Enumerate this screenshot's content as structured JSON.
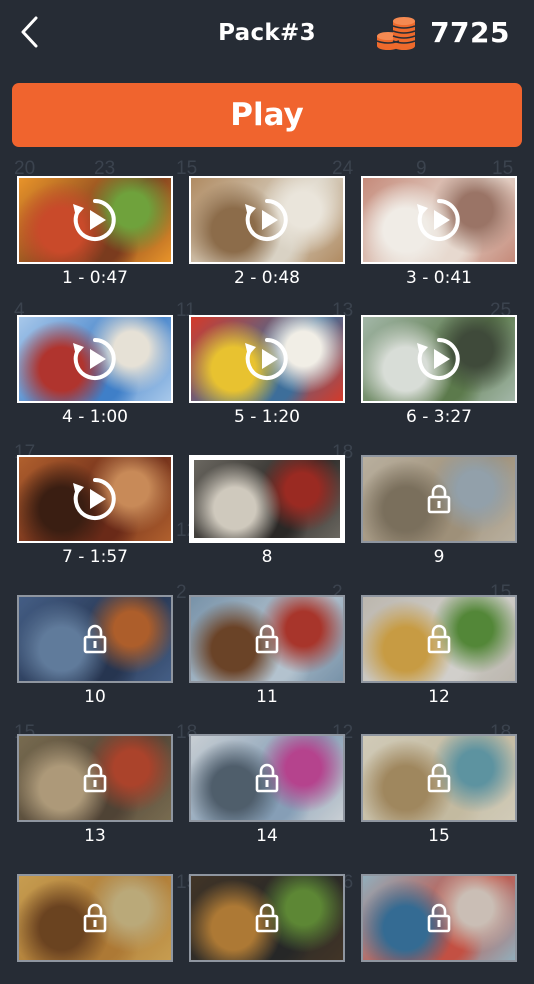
{
  "header": {
    "title": "Pack#3",
    "coins": "7725"
  },
  "play_button": {
    "label": "Play"
  },
  "bg_numbers": [
    "20",
    "23",
    "15",
    "24",
    "9",
    "15",
    "4",
    "11",
    "13",
    "25",
    "17",
    "12",
    "18",
    "2",
    "2",
    "15",
    "15",
    "18",
    "12",
    "18",
    "15",
    "16"
  ],
  "levels": [
    {
      "label": "1 - 0:47",
      "state": "played",
      "palette": [
        "#7a3b1e",
        "#e8942a",
        "#c94a2a",
        "#6fa23c"
      ]
    },
    {
      "label": "2 - 0:48",
      "state": "played",
      "palette": [
        "#d9d2c4",
        "#b08b62",
        "#8c6c4a",
        "#eae5db"
      ]
    },
    {
      "label": "3 - 0:41",
      "state": "played",
      "palette": [
        "#e7d9cf",
        "#c58a7a",
        "#f0ece6",
        "#9a7466"
      ]
    },
    {
      "label": "4 - 1:00",
      "state": "played",
      "palette": [
        "#3f7fc8",
        "#a8c8ea",
        "#b0342e",
        "#e6e1d6"
      ]
    },
    {
      "label": "5 - 1:20",
      "state": "played",
      "palette": [
        "#3d6e9a",
        "#d43a2a",
        "#e8c230",
        "#f1eee6"
      ]
    },
    {
      "label": "6 - 3:27",
      "state": "played",
      "palette": [
        "#5c7a4c",
        "#a3b7a8",
        "#d8ddd7",
        "#3f4a3a"
      ]
    },
    {
      "label": "7 - 1:57",
      "state": "played",
      "palette": [
        "#6a2a18",
        "#b0602e",
        "#3a1e12",
        "#c88a58"
      ]
    },
    {
      "label": "8",
      "state": "current",
      "palette": [
        "#2a2826",
        "#6a6760",
        "#cfc9bd",
        "#9a2a22"
      ]
    },
    {
      "label": "9",
      "state": "locked",
      "palette": [
        "#b7a58a",
        "#d6cab6",
        "#8c7e68",
        "#a8b8c4"
      ]
    },
    {
      "label": "10",
      "state": "locked",
      "palette": [
        "#2a3a5a",
        "#4d6a98",
        "#6e8cb2",
        "#c86a2e"
      ]
    },
    {
      "label": "11",
      "state": "locked",
      "palette": [
        "#cfe0ee",
        "#8aa8c2",
        "#7a4a2a",
        "#c23a2e"
      ]
    },
    {
      "label": "12",
      "state": "locked",
      "palette": [
        "#f2efea",
        "#d9d2c8",
        "#e7b24a",
        "#5f9a3e"
      ]
    },
    {
      "label": "13",
      "state": "locked",
      "palette": [
        "#5a4a3a",
        "#8a7a5a",
        "#c8b08a",
        "#c64a2e"
      ]
    },
    {
      "label": "14",
      "state": "locked",
      "palette": [
        "#9ab6d2",
        "#e8eef4",
        "#5a6a7a",
        "#d24aa2"
      ]
    },
    {
      "label": "15",
      "state": "locked",
      "palette": [
        "#e2d6b8",
        "#f2ead4",
        "#b89a6a",
        "#6aa8b8"
      ]
    },
    {
      "label": "",
      "state": "locked",
      "palette": [
        "#c88a3a",
        "#e6b45a",
        "#7a4a22",
        "#d8c28a"
      ]
    },
    {
      "label": "",
      "state": "locked",
      "palette": [
        "#2a2a2a",
        "#4a3a2a",
        "#c88a3a",
        "#6a9a3a"
      ]
    },
    {
      "label": "",
      "state": "locked",
      "palette": [
        "#e25a4a",
        "#a8c8d8",
        "#3a7aa8",
        "#eadbd0"
      ]
    }
  ],
  "icons": {
    "back": "chevron-left-icon",
    "coins": "coin-stack-icon",
    "replay": "replay-icon",
    "lock": "lock-icon"
  },
  "colors": {
    "background": "#262c35",
    "accent": "#f0642e",
    "coin": "#ee6a2c"
  }
}
